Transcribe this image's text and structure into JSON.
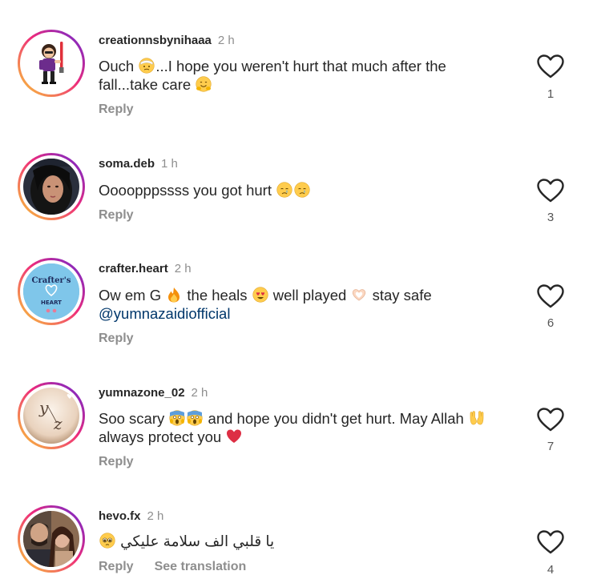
{
  "comments": [
    {
      "username": "creationnsbynihaaa",
      "time": "2 h",
      "text_parts": [
        "Ouch ",
        "...I hope you weren't hurt that much after the fall...take care "
      ],
      "emojis": [
        "face-with-head-bandage-emoji",
        "hugging-face-emoji"
      ],
      "reply": "Reply",
      "likes": "1",
      "avatar": "cartoon-girl-lightsaber-avatar"
    },
    {
      "username": "soma.deb",
      "time": "1 h",
      "text_parts": [
        "Oooopppssss you got hurt "
      ],
      "emojis": [
        "crying-face-emoji",
        "crying-face-emoji"
      ],
      "reply": "Reply",
      "likes": "3",
      "avatar": "portrait-avatar"
    },
    {
      "username": "crafter.heart",
      "time": "2 h",
      "text_parts": [
        "Ow em G ",
        " the heals ",
        " well played ",
        " stay safe"
      ],
      "mention": "@yumnazaidiofficial",
      "emojis": [
        "fire-emoji",
        "heart-eyes-emoji",
        "heart-hands-emoji"
      ],
      "reply": "Reply",
      "likes": "6",
      "avatar": "crafters-heart-logo-avatar",
      "avatar_text": {
        "top": "Crafter's",
        "bottom": "HEART"
      }
    },
    {
      "username": "yumnazone_02",
      "time": "2 h",
      "text_parts": [
        "Soo scary ",
        " and hope you didn't get hurt.  May Allah ",
        " always protect you "
      ],
      "emojis": [
        "screaming-face-emoji",
        "screaming-face-emoji",
        "open-hands-emoji",
        "red-heart-emoji"
      ],
      "reply": "Reply",
      "likes": "7",
      "avatar": "yz-monogram-avatar",
      "avatar_text": {
        "y": "y",
        "z": "z"
      }
    },
    {
      "username": "hevo.fx",
      "time": "2 h",
      "text": "يا قلبي الف سلامة عليكي",
      "emojis": [
        "pleading-face-emoji"
      ],
      "reply": "Reply",
      "see_translation": "See translation",
      "likes": "4",
      "avatar": "couple-photo-avatar"
    }
  ],
  "colors": {
    "text": "#262626",
    "muted": "#8e8e8e",
    "mention": "#00376b",
    "ring_start": "#f9ce34",
    "ring_mid": "#ee2a7b",
    "ring_end": "#6228d7"
  }
}
